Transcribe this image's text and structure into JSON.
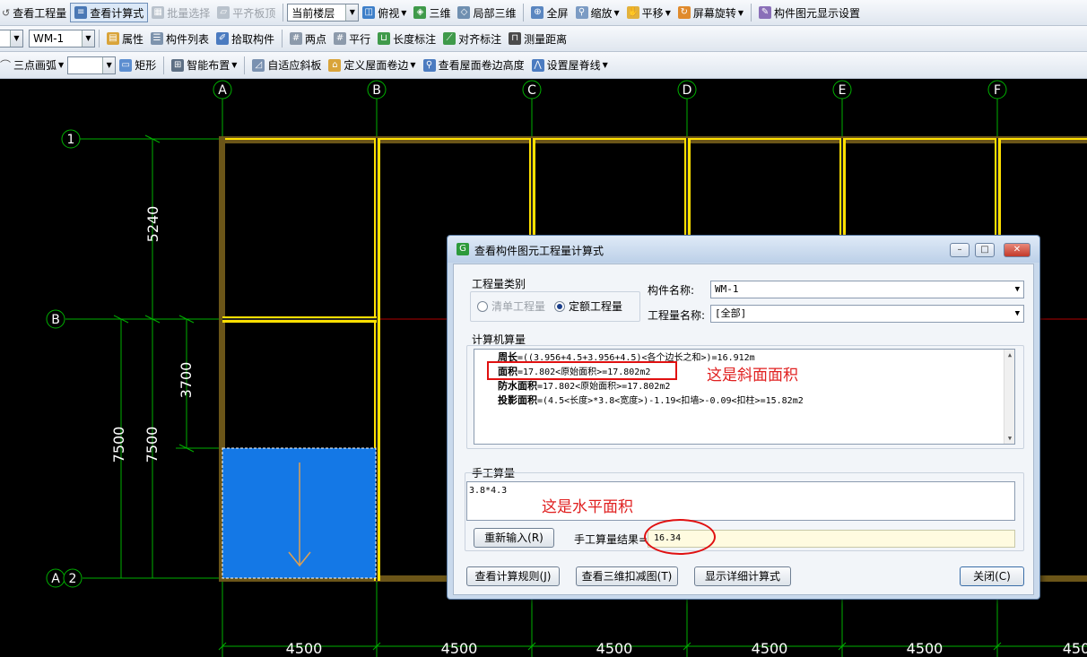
{
  "toolbar1": {
    "view_quantity": "查看工程量",
    "view_formula": "查看计算式",
    "batch_select": "批量选择",
    "flush_slab": "平齐板顶",
    "floor_select": "当前楼层",
    "top_view": "俯视",
    "three_d": "三维",
    "local_3d": "局部三维",
    "full_screen": "全屏",
    "zoom": "缩放",
    "pan": "平移",
    "screen_rotate": "屏幕旋转",
    "display_settings": "构件图元显示设置"
  },
  "toolbar2": {
    "component_select": "WM-1",
    "properties": "属性",
    "component_list": "构件列表",
    "pick_component": "拾取构件",
    "two_points": "两点",
    "parallel": "平行",
    "length_dim": "长度标注",
    "align_dim": "对齐标注",
    "measure_distance": "测量距离"
  },
  "toolbar3": {
    "arc_mode": "三点画弧",
    "rectangle": "矩形",
    "smart_layout": "智能布置",
    "auto_slope": "自适应斜板",
    "define_edge": "定义屋面卷边",
    "view_edge_height": "查看屋面卷边高度",
    "set_ridge": "设置屋脊线"
  },
  "grid": {
    "col_labels": [
      "A",
      "B",
      "C",
      "D",
      "E",
      "F"
    ],
    "row_labels": [
      "1",
      "B",
      "A",
      "2"
    ],
    "dims": {
      "d5240": "5240",
      "d3700": "3700",
      "d7500a": "7500",
      "d7500b": "7500"
    },
    "bottom_dims": [
      "4500",
      "4500",
      "4500",
      "4500",
      "4500",
      "450"
    ]
  },
  "dialog": {
    "title": "查看构件图元工程量计算式",
    "qty_type_label": "工程量类别",
    "radio_bill": "清单工程量",
    "radio_quota": "定额工程量",
    "component_name_label": "构件名称:",
    "component_name_value": "WM-1",
    "qty_name_label": "工程量名称:",
    "qty_name_value": "[全部]",
    "computer_calc_label": "计算机算量",
    "calc_lines": [
      {
        "name": "周长",
        "expr": "=((3.956+4.5+3.956+4.5)<各个边长之和>)=16.912m"
      },
      {
        "name": "面积",
        "expr": "=17.802<原始面积>=17.802m2"
      },
      {
        "name": "防水面积",
        "expr": "=17.802<原始面积>=17.802m2"
      },
      {
        "name": "投影面积",
        "expr": "=(4.5<长度>*3.8<宽度>)-1.19<扣墙>-0.09<扣柱>=15.82m2"
      }
    ],
    "manual_calc_label": "手工算量",
    "manual_expr": "3.8*4.3",
    "reinput_button": "重新输入(R)",
    "manual_result_label": "手工算量结果=",
    "manual_result_value": "16.34",
    "view_rules_button": "查看计算规则(J)",
    "view_3d_button": "查看三维扣减图(T)",
    "show_detail_button": "显示详细计算式",
    "close_button": "关闭(C)"
  },
  "annotations": {
    "slope_area": "这是斜面面积",
    "horizontal_area": "这是水平面积"
  },
  "colors": {
    "grid_line": "#00c000",
    "axis_red": "#c00000",
    "wall_yellow": "#ffe000",
    "wall_brown": "#8a6a20",
    "slab_blue": "#1478e6",
    "arrow_orange": "#e0a050",
    "annotation_red": "#e02020"
  }
}
